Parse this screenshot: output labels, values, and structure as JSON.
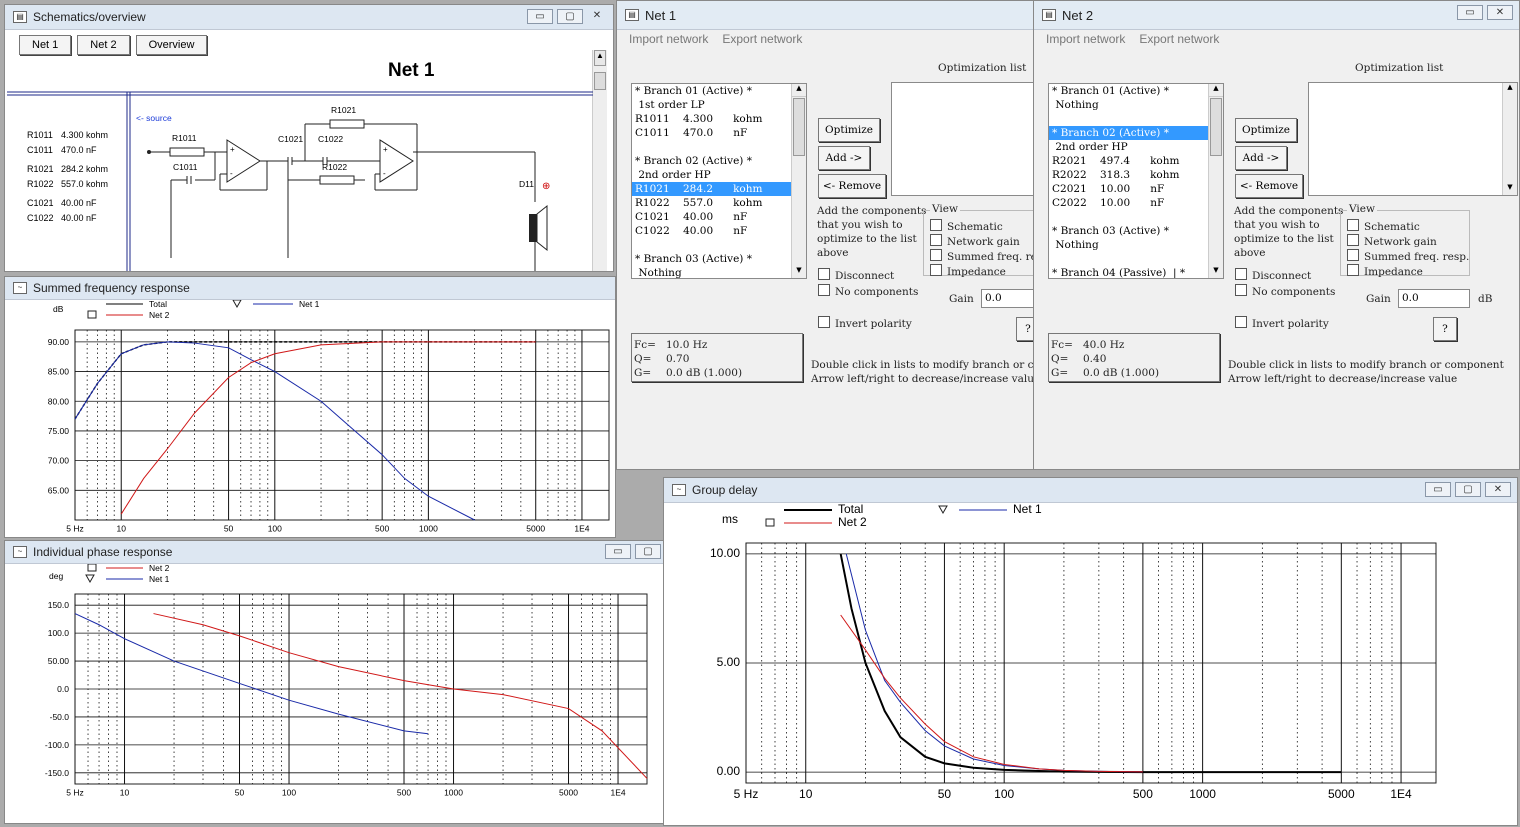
{
  "schematic": {
    "title": "Schematics/overview",
    "tabs": [
      "Net 1",
      "Net 2",
      "Overview"
    ],
    "heading": "Net 1",
    "source_label": "<- source",
    "values": [
      {
        "name": "R1011",
        "value": "4.300 kohm"
      },
      {
        "name": "C1011",
        "value": "470.0 nF"
      },
      {
        "name": "R1021",
        "value": "284.2 kohm"
      },
      {
        "name": "R1022",
        "value": "557.0 kohm"
      },
      {
        "name": "C1021",
        "value": "40.00 nF"
      },
      {
        "name": "C1022",
        "value": "40.00 nF"
      }
    ],
    "parts": {
      "r1011": "R1011",
      "c1011": "C1011",
      "c1021": "C1021",
      "c1022": "C1022",
      "r1021": "R1021",
      "r1022": "R1022",
      "d11": "D11"
    }
  },
  "freq": {
    "title": "Summed frequency response",
    "unit": "dB",
    "legend": {
      "total": "Total",
      "net1": "Net 1",
      "net2": "Net 2"
    },
    "yticks": [
      "90.00",
      "85.00",
      "80.00",
      "75.00",
      "70.00",
      "65.00"
    ],
    "xticks": [
      "5 Hz",
      "10",
      "50",
      "100",
      "500",
      "1000",
      "5000",
      "1E4"
    ]
  },
  "phase": {
    "title": "Individual phase response",
    "unit": "deg",
    "legend": {
      "net2": "Net 2",
      "net1": "Net 1"
    },
    "yticks": [
      "150.0",
      "100.0",
      "50.00",
      "0.0",
      "-50.0",
      "-100.0",
      "-150.0"
    ],
    "xticks": [
      "5 Hz",
      "10",
      "50",
      "100",
      "500",
      "1000",
      "5000",
      "1E4"
    ]
  },
  "delay": {
    "title": "Group delay",
    "unit": "ms",
    "legend": {
      "total": "Total",
      "net1": "Net 1",
      "net2": "Net 2"
    },
    "yticks": [
      "10.00",
      "5.00",
      "0.00"
    ],
    "xticks": [
      "5 Hz",
      "10",
      "50",
      "100",
      "500",
      "1000",
      "5000",
      "1E4"
    ]
  },
  "net1": {
    "title": "Net 1",
    "menu": [
      "Import network",
      "Export network"
    ],
    "rows": [
      "* Branch 01 (Active) *",
      " 1st order LP",
      "R1011    4.300      kohm",
      "C1011    470.0      nF",
      "",
      "* Branch 02 (Active) *",
      " 2nd order HP",
      "R1021    284.2      kohm",
      "R1022    557.0      kohm",
      "C1021    40.00      nF",
      "C1022    40.00      nF",
      "",
      "* Branch 03 (Active) *",
      " Nothing"
    ],
    "selected": 7,
    "optimization_label": "Optimization list",
    "buttons": [
      "Optimize",
      "Add ->",
      "<- Remove"
    ],
    "help": [
      "Add the components",
      "that you wish to",
      "optimize to the list",
      "above"
    ],
    "view_label": "View",
    "view_items": [
      "Schematic",
      "Network gain",
      "Summed freq. resp.",
      "Impedance"
    ],
    "disconnect": "Disconnect",
    "no_components": "No components",
    "gain_label": "Gain",
    "gain_value": "0.0",
    "invert": "Invert polarity",
    "q_button": "?",
    "fc": "Fc=",
    "fc_val": "10.0 Hz",
    "q": "Q=",
    "q_val": "0.70",
    "g": "G=",
    "g_val": "0.0 dB (1.000)",
    "hint1": "Double click in lists to modify branch or component",
    "hint2": "Arrow left/right to decrease/increase value"
  },
  "net2": {
    "title": "Net 2",
    "menu": [
      "Import network",
      "Export network"
    ],
    "rows": [
      "* Branch 01 (Active) *",
      " Nothing",
      "",
      "* Branch 02 (Active) *",
      " 2nd order HP",
      "R2021    497.4      kohm",
      "R2022    318.3      kohm",
      "C2021    10.00      nF",
      "C2022    10.00      nF",
      "",
      "* Branch 03 (Active) *",
      " Nothing",
      "",
      "* Branch 04 (Passive)  | *"
    ],
    "selected": 3,
    "optimization_label": "Optimization list",
    "buttons": [
      "Optimize",
      "Add ->",
      "<- Remove"
    ],
    "help": [
      "Add the components",
      "that you wish to",
      "optimize to the list",
      "above"
    ],
    "view_label": "View",
    "view_items": [
      "Schematic",
      "Network gain",
      "Summed freq. resp.",
      "Impedance"
    ],
    "disconnect": "Disconnect",
    "no_components": "No components",
    "gain_label": "Gain",
    "gain_value": "0.0",
    "gain_unit": "dB",
    "invert": "Invert polarity",
    "q_button": "?",
    "fc": "Fc=",
    "fc_val": "40.0 Hz",
    "q": "Q=",
    "q_val": "0.40",
    "g": "G=",
    "g_val": "0.0 dB (1.000)",
    "hint1": "Double click in lists to modify branch or component",
    "hint2": "Arrow left/right to decrease/increase value"
  },
  "chart_data": [
    {
      "type": "line",
      "title": "Summed frequency response",
      "ylabel": "dB",
      "xscale": "log",
      "xlim": [
        5,
        15000
      ],
      "ylim": [
        60,
        92
      ],
      "series": [
        {
          "name": "Total",
          "x": [
            5,
            7,
            10,
            14,
            20,
            30,
            50,
            70,
            100,
            200,
            500,
            1000,
            2000,
            5000
          ],
          "y": [
            77,
            83,
            88,
            89.5,
            90,
            90,
            90,
            90,
            90,
            90,
            90,
            90,
            90,
            90
          ]
        },
        {
          "name": "Net 1",
          "x": [
            5,
            7,
            10,
            14,
            20,
            30,
            50,
            70,
            100,
            200,
            300,
            500,
            700,
            1000,
            2000
          ],
          "y": [
            77,
            83,
            88,
            89.5,
            90,
            89.8,
            89,
            87,
            85,
            80,
            76,
            71,
            67,
            64,
            60
          ]
        },
        {
          "name": "Net 2",
          "x": [
            10,
            14,
            20,
            30,
            50,
            70,
            100,
            200,
            500,
            700,
            1000,
            5000
          ],
          "y": [
            61,
            67,
            72,
            78,
            84,
            86.5,
            88,
            89.5,
            90,
            90,
            90,
            90
          ]
        }
      ]
    },
    {
      "type": "line",
      "title": "Individual phase response",
      "ylabel": "deg",
      "xscale": "log",
      "xlim": [
        5,
        15000
      ],
      "ylim": [
        -170,
        170
      ],
      "series": [
        {
          "name": "Net 2",
          "x": [
            15,
            30,
            50,
            100,
            200,
            500,
            1000,
            2000,
            5000,
            8000,
            15000
          ],
          "y": [
            135,
            115,
            95,
            65,
            40,
            15,
            0,
            -10,
            -35,
            -75,
            -160
          ]
        },
        {
          "name": "Net 1",
          "x": [
            5,
            7,
            10,
            20,
            50,
            100,
            200,
            500,
            700
          ],
          "y": [
            135,
            115,
            90,
            50,
            10,
            -20,
            -45,
            -75,
            -80
          ]
        }
      ]
    },
    {
      "type": "line",
      "title": "Group delay",
      "ylabel": "ms",
      "xscale": "log",
      "xlim": [
        5,
        15000
      ],
      "ylim": [
        -0.5,
        10.5
      ],
      "series": [
        {
          "name": "Total",
          "x": [
            15,
            17,
            20,
            25,
            30,
            40,
            50,
            70,
            100,
            150,
            200,
            300,
            500,
            1000,
            5000
          ],
          "y": [
            10,
            7.5,
            5,
            2.8,
            1.6,
            0.7,
            0.4,
            0.2,
            0.1,
            0.05,
            0.02,
            0.01,
            0,
            0,
            0
          ]
        },
        {
          "name": "Net 1",
          "x": [
            16,
            20,
            25,
            30,
            40,
            50,
            70,
            100,
            150,
            200,
            300,
            500
          ],
          "y": [
            10,
            6.5,
            4.2,
            3.2,
            1.9,
            1.2,
            0.6,
            0.3,
            0.15,
            0.08,
            0.03,
            0.01
          ]
        },
        {
          "name": "Net 2",
          "x": [
            15,
            20,
            25,
            30,
            40,
            50,
            70,
            100,
            150,
            200,
            300,
            500
          ],
          "y": [
            7.2,
            5.6,
            4.3,
            3.4,
            2.2,
            1.4,
            0.7,
            0.35,
            0.15,
            0.08,
            0.03,
            0.01
          ]
        }
      ]
    }
  ]
}
